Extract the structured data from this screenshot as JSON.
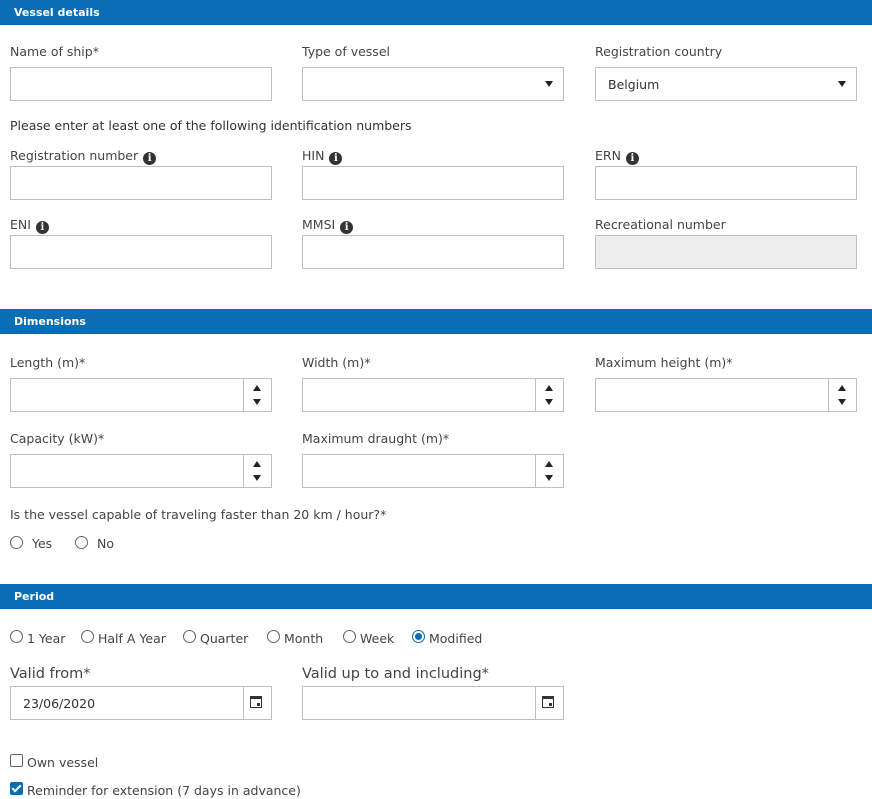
{
  "sections": {
    "vessel_details": "Vessel details",
    "dimensions": "Dimensions",
    "period": "Period"
  },
  "vessel": {
    "name_label": "Name of ship*",
    "type_label": "Type of vessel",
    "type_value": "",
    "country_label": "Registration country",
    "country_value": "Belgium",
    "id_instruction": "Please enter at least one of the following identification numbers",
    "registration_number_label": "Registration number",
    "hin_label": "HIN",
    "ern_label": "ERN",
    "eni_label": "ENI",
    "mmsi_label": "MMSI",
    "recreational_label": "Recreational number",
    "info_glyph": "i"
  },
  "dimensions": {
    "length_label": "Length (m)*",
    "width_label": "Width (m)*",
    "max_height_label": "Maximum height (m)*",
    "capacity_label": "Capacity (kW)*",
    "max_draught_label": "Maximum draught (m)*",
    "speed_question": "Is the vessel capable of traveling faster than 20 km / hour?*",
    "yes_label": "Yes",
    "no_label": "No"
  },
  "period": {
    "options": [
      "1 Year",
      "Half A Year",
      "Quarter",
      "Month",
      "Week",
      "Modified"
    ],
    "selected": "Modified",
    "valid_from_label": "Valid from*",
    "valid_from_value": "23/06/2020",
    "valid_until_label": "Valid up to and including*",
    "valid_until_value": "",
    "own_vessel_label": "Own vessel",
    "own_vessel_checked": false,
    "reminder_label": "Reminder for extension (7 days in advance)",
    "reminder_checked": true
  },
  "colors": {
    "accent": "#0a6eb4"
  }
}
